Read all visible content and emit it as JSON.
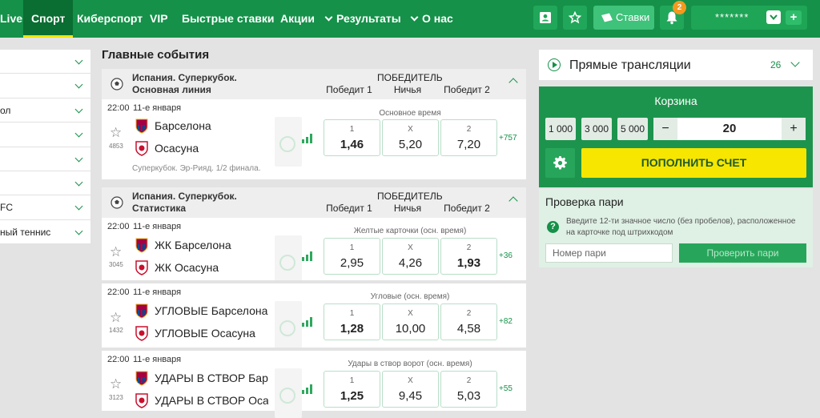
{
  "nav": {
    "items": [
      "Live",
      "Спорт",
      "Киберспорт",
      "VIP",
      "Быстрые ставки",
      "Акции",
      "Результаты",
      "О нас"
    ],
    "active": "Спорт"
  },
  "toolbar": {
    "bets_label": "Ставки",
    "notifications_count": "2",
    "account_masked": "*******",
    "account_plus": "+"
  },
  "sidebar": {
    "items": [
      "",
      "",
      "ол",
      "",
      "",
      "",
      "FC",
      "ный теннис"
    ]
  },
  "main": {
    "title": "Главные события",
    "groups": [
      {
        "league_line1": "Испания. Суперкубок.",
        "league_line2": "Основная линия",
        "market": "ПОБЕДИТЕЛЬ",
        "outcomes": [
          "Победит 1",
          "Ничья",
          "Победит 2"
        ],
        "events": [
          {
            "time": "22:00",
            "date": "11-е января",
            "id": "4853",
            "team1": "Барселона",
            "team2": "Осасуна",
            "note": "Суперкубок. Эр-Рияд. 1/2 финала.",
            "period": "Основное время",
            "odds": [
              {
                "label": "1",
                "value": "1,46",
                "bold": true
              },
              {
                "label": "X",
                "value": "5,20",
                "bold": false
              },
              {
                "label": "2",
                "value": "7,20",
                "bold": false
              }
            ],
            "more": "+757"
          }
        ]
      },
      {
        "league_line1": "Испания. Суперкубок.",
        "league_line2": "Статистика",
        "market": "ПОБЕДИТЕЛЬ",
        "outcomes": [
          "Победит 1",
          "Ничья",
          "Победит 2"
        ],
        "events": [
          {
            "time": "22:00",
            "date": "11-е января",
            "id": "3045",
            "team1": "ЖК Барселона",
            "team2": "ЖК Осасуна",
            "period": "Желтые карточки (осн. время)",
            "odds": [
              {
                "label": "1",
                "value": "2,95",
                "bold": false
              },
              {
                "label": "X",
                "value": "4,26",
                "bold": false
              },
              {
                "label": "2",
                "value": "1,93",
                "bold": true
              }
            ],
            "more": "+36"
          },
          {
            "time": "22:00",
            "date": "11-е января",
            "id": "1432",
            "team1": "УГЛОВЫЕ Барселона",
            "team2": "УГЛОВЫЕ Осасуна",
            "period": "Угловые (осн. время)",
            "odds": [
              {
                "label": "1",
                "value": "1,28",
                "bold": true
              },
              {
                "label": "X",
                "value": "10,00",
                "bold": false
              },
              {
                "label": "2",
                "value": "4,58",
                "bold": false
              }
            ],
            "more": "+82"
          },
          {
            "time": "22:00",
            "date": "11-е января",
            "id": "3123",
            "team1": "УДАРЫ В СТВОР Бар…",
            "team2": "УДАРЫ В СТВОР Оса…",
            "period": "Удары в створ ворот (осн. время)",
            "odds": [
              {
                "label": "1",
                "value": "1,25",
                "bold": true
              },
              {
                "label": "X",
                "value": "9,45",
                "bold": false
              },
              {
                "label": "2",
                "value": "5,03",
                "bold": false
              }
            ],
            "more": "+55"
          }
        ]
      }
    ]
  },
  "right": {
    "streams_label": "Прямые трансляции",
    "streams_count": "26",
    "cart_title": "Корзина",
    "quick_amounts": [
      "1 000",
      "3 000",
      "5 000"
    ],
    "stepper_minus": "−",
    "stepper_value": "20",
    "stepper_plus": "+",
    "topup_label": "ПОПОЛНИТЬ СЧЕТ",
    "check_title": "Проверка пари",
    "check_hint": "Введите 12-ти значное число (без пробелов), расположенное на карточке под штрихкодом",
    "check_placeholder": "Номер пари",
    "check_button": "Проверить пари"
  },
  "colors": {
    "brand": "#159149",
    "accent": "#f6e600",
    "badge": "#f39a1e"
  }
}
